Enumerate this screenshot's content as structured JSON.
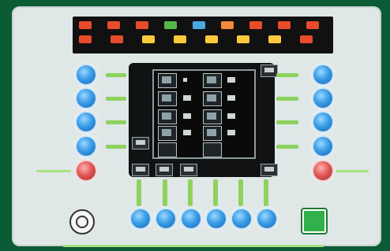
{
  "device": {
    "indicator_rows": {
      "top": [
        {
          "icon": "cross-section-icon",
          "color": "#e94c2c"
        },
        {
          "icon": "plug-icon",
          "color": "#e94c2c"
        },
        {
          "icon": "clock-icon",
          "color": "#e94c2c"
        },
        {
          "icon": "bulb-icon",
          "color": "#56b84a"
        },
        {
          "icon": "ice-icon",
          "color": "#4aa8e6"
        },
        {
          "icon": "snow-icon",
          "color": "#f08a3c"
        },
        {
          "icon": "door-icon",
          "color": "#e94c2c"
        },
        {
          "icon": "warning-icon",
          "color": "#e94c2c"
        },
        {
          "icon": "arrows-icon",
          "color": "#e94c2c"
        }
      ],
      "bottom": [
        {
          "icon": "fan-icon",
          "color": "#e94c2c"
        },
        {
          "icon": "fan-icon",
          "color": "#e94c2c"
        },
        {
          "icon": "lock-icon",
          "color": "#ffc93c"
        },
        {
          "icon": "lock-icon",
          "color": "#ffc93c"
        },
        {
          "icon": "lock-icon",
          "color": "#ffc93c"
        },
        {
          "icon": "lock-icon",
          "color": "#ffc93c"
        },
        {
          "icon": "stand-icon",
          "color": "#ffc93c"
        },
        {
          "icon": "stop-icon",
          "color": "#e94c2c"
        }
      ]
    },
    "screen": {
      "cells": [
        "thermo-icon",
        "sun-icon",
        "sensor-icon",
        "power-icon",
        "face-icon",
        "lamp-icon",
        "vent-icon",
        "gauge-icon",
        "blank",
        "blank"
      ],
      "corner_icon": "settings-icon",
      "soft_keys": [
        "up-icon",
        "down-icon",
        "grid-icon",
        "back-icon"
      ]
    },
    "logo": "manufacturer-logo-icon",
    "colors": {
      "panel": "#dfe7e7",
      "blue_button": "#2f86d8",
      "red_button": "#d94545",
      "led_green": "#8fd15d"
    }
  }
}
